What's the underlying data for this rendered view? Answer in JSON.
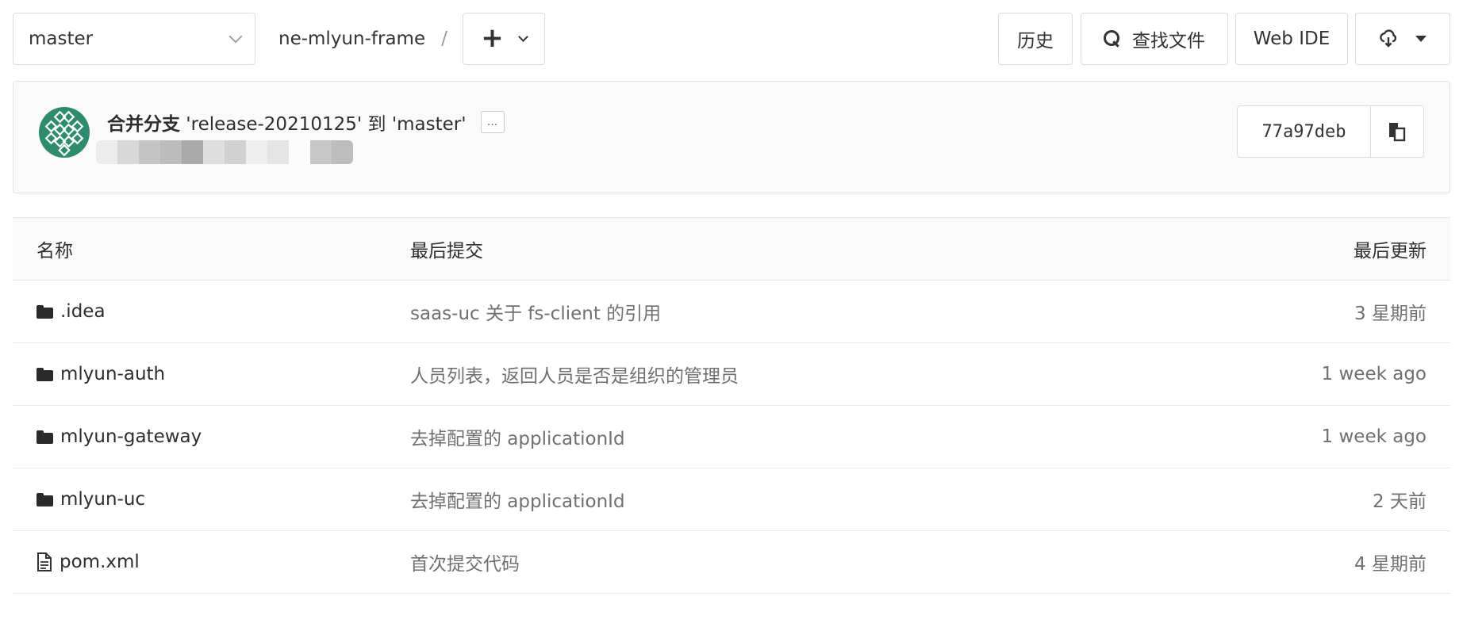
{
  "toolbar": {
    "branch": "master",
    "repo": "ne-mlyun-frame",
    "separator": "/",
    "add_label": "+",
    "history_label": "历史",
    "find_file_label": "查找文件",
    "web_ide_label": "Web IDE"
  },
  "commit": {
    "title_cn": "合并分支",
    "title_rest": " 'release-20210125' 到 'master'",
    "ellipsis": "...",
    "sha": "77a97deb",
    "avatar_color": "#2e8b6e"
  },
  "table": {
    "headers": {
      "name": "名称",
      "last_commit": "最后提交",
      "last_update": "最后更新"
    },
    "rows": [
      {
        "type": "folder",
        "name": ".idea",
        "commit": "saas-uc 关于 fs-client 的引用",
        "date": "3 星期前"
      },
      {
        "type": "folder",
        "name": "mlyun-auth",
        "commit": "人员列表，返回人员是否是组织的管理员",
        "date": "1 week ago"
      },
      {
        "type": "folder",
        "name": "mlyun-gateway",
        "commit": "去掉配置的 applicationId",
        "date": "1 week ago"
      },
      {
        "type": "folder",
        "name": "mlyun-uc",
        "commit": "去掉配置的 applicationId",
        "date": "2 天前"
      },
      {
        "type": "file",
        "name": "pom.xml",
        "commit": "首次提交代码",
        "date": "4 星期前"
      }
    ]
  }
}
